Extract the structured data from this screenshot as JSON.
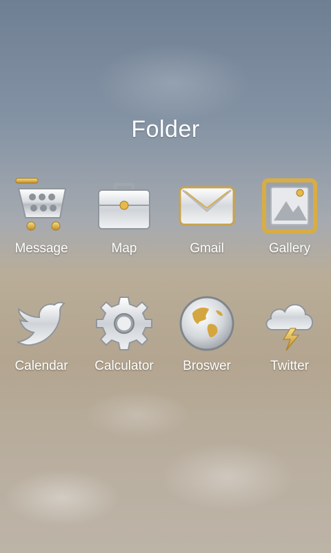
{
  "folder": {
    "title": "Folder"
  },
  "apps": [
    {
      "label": "Message",
      "icon": "shopping-cart-icon"
    },
    {
      "label": "Map",
      "icon": "briefcase-icon"
    },
    {
      "label": "Gmail",
      "icon": "envelope-icon"
    },
    {
      "label": "Gallery",
      "icon": "picture-frame-icon"
    },
    {
      "label": "Calendar",
      "icon": "bird-icon"
    },
    {
      "label": "Calculator",
      "icon": "gear-icon"
    },
    {
      "label": "Broswer",
      "icon": "globe-icon"
    },
    {
      "label": "Twitter",
      "icon": "storm-cloud-icon"
    }
  ],
  "colors": {
    "silver": "#e6e8ea",
    "gold": "#d2a43a"
  }
}
